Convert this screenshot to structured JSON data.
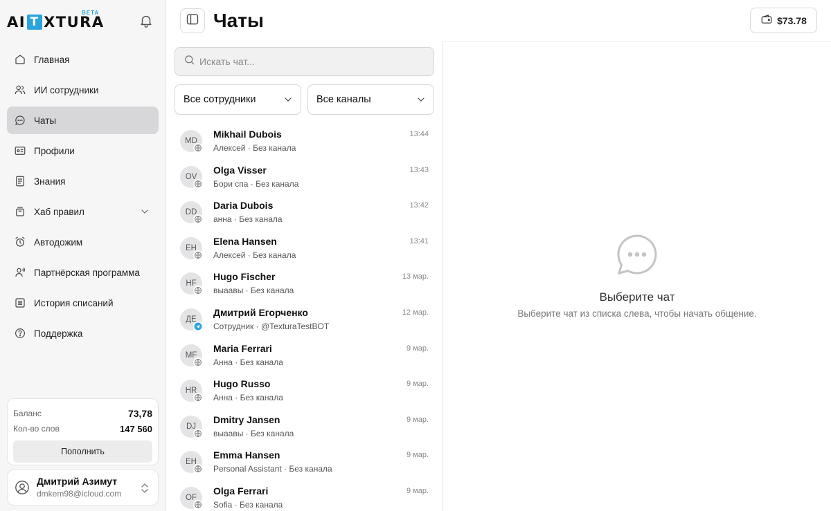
{
  "brand": {
    "logo_prefix": "AI",
    "logo_box": "T",
    "logo_suffix": "XTURA",
    "beta": "BETA"
  },
  "icons": {
    "bell": "bell-icon",
    "wallet": "wallet-icon",
    "panel": "sidebar-panel-icon",
    "search": "search-icon",
    "empty": "chat-bubble-icon",
    "web": "globe-icon",
    "telegram": "telegram-icon"
  },
  "colors": {
    "accent": "#2aa4dc",
    "active_nav": "#d7d7d9",
    "telegram": "#2aa4dc"
  },
  "sidebar": {
    "items": [
      {
        "label": "Главная",
        "icon": "home-icon"
      },
      {
        "label": "ИИ сотрудники",
        "icon": "users-icon"
      },
      {
        "label": "Чаты",
        "icon": "chat-icon",
        "active": true
      },
      {
        "label": "Профили",
        "icon": "profile-card-icon"
      },
      {
        "label": "Знания",
        "icon": "document-icon"
      },
      {
        "label": "Хаб правил",
        "icon": "archive-icon",
        "expandable": true
      },
      {
        "label": "Автодожим",
        "icon": "alarm-icon"
      },
      {
        "label": "Партнёрская программа",
        "icon": "partner-icon"
      },
      {
        "label": "История списаний",
        "icon": "list-icon"
      },
      {
        "label": "Поддержка",
        "icon": "help-icon"
      }
    ],
    "balance": {
      "balance_label": "Баланс",
      "balance_value": "73,78",
      "words_label": "Кол-во слов",
      "words_value": "147 560",
      "topup_label": "Пополнить"
    },
    "user": {
      "name": "Дмитрий Азимут",
      "email": "dmkem98@icloud.com"
    }
  },
  "header": {
    "title": "Чаты",
    "wallet": "$73.78"
  },
  "chat_list": {
    "search_placeholder": "Искать чат...",
    "filter_employees": "Все сотрудники",
    "filter_channels": "Все каналы",
    "chats": [
      {
        "initials": "MD",
        "name": "Mikhail Dubois",
        "sub": "Алексей · Без канала",
        "time": "13:44",
        "channel": "web"
      },
      {
        "initials": "OV",
        "name": "Olga Visser",
        "sub": "Бори спа · Без канала",
        "time": "13:43",
        "channel": "web"
      },
      {
        "initials": "DD",
        "name": "Daria Dubois",
        "sub": "анна · Без канала",
        "time": "13:42",
        "channel": "web"
      },
      {
        "initials": "EH",
        "name": "Elena Hansen",
        "sub": "Алексей · Без канала",
        "time": "13:41",
        "channel": "web"
      },
      {
        "initials": "HF",
        "name": "Hugo Fischer",
        "sub": "выаавы · Без канала",
        "time": "13 мар.",
        "channel": "web"
      },
      {
        "initials": "ДЕ",
        "name": "Дмитрий Егорченко",
        "sub": "Сотрудник · @TexturaTestBOT",
        "time": "12 мар.",
        "channel": "telegram"
      },
      {
        "initials": "MF",
        "name": "Maria Ferrari",
        "sub": "Анна · Без канала",
        "time": "9 мар.",
        "channel": "web"
      },
      {
        "initials": "HR",
        "name": "Hugo Russo",
        "sub": "Анна · Без канала",
        "time": "9 мар.",
        "channel": "web"
      },
      {
        "initials": "DJ",
        "name": "Dmitry Jansen",
        "sub": "выаавы · Без канала",
        "time": "9 мар.",
        "channel": "web"
      },
      {
        "initials": "EH",
        "name": "Emma Hansen",
        "sub": "Personal Assistant · Без канала",
        "time": "9 мар.",
        "channel": "web"
      },
      {
        "initials": "OF",
        "name": "Olga Ferrari",
        "sub": "Sofia · Без канала",
        "time": "9 мар.",
        "channel": "web"
      }
    ]
  },
  "empty_state": {
    "title": "Выберите чат",
    "subtitle": "Выберите чат из списка слева, чтобы начать общение."
  }
}
